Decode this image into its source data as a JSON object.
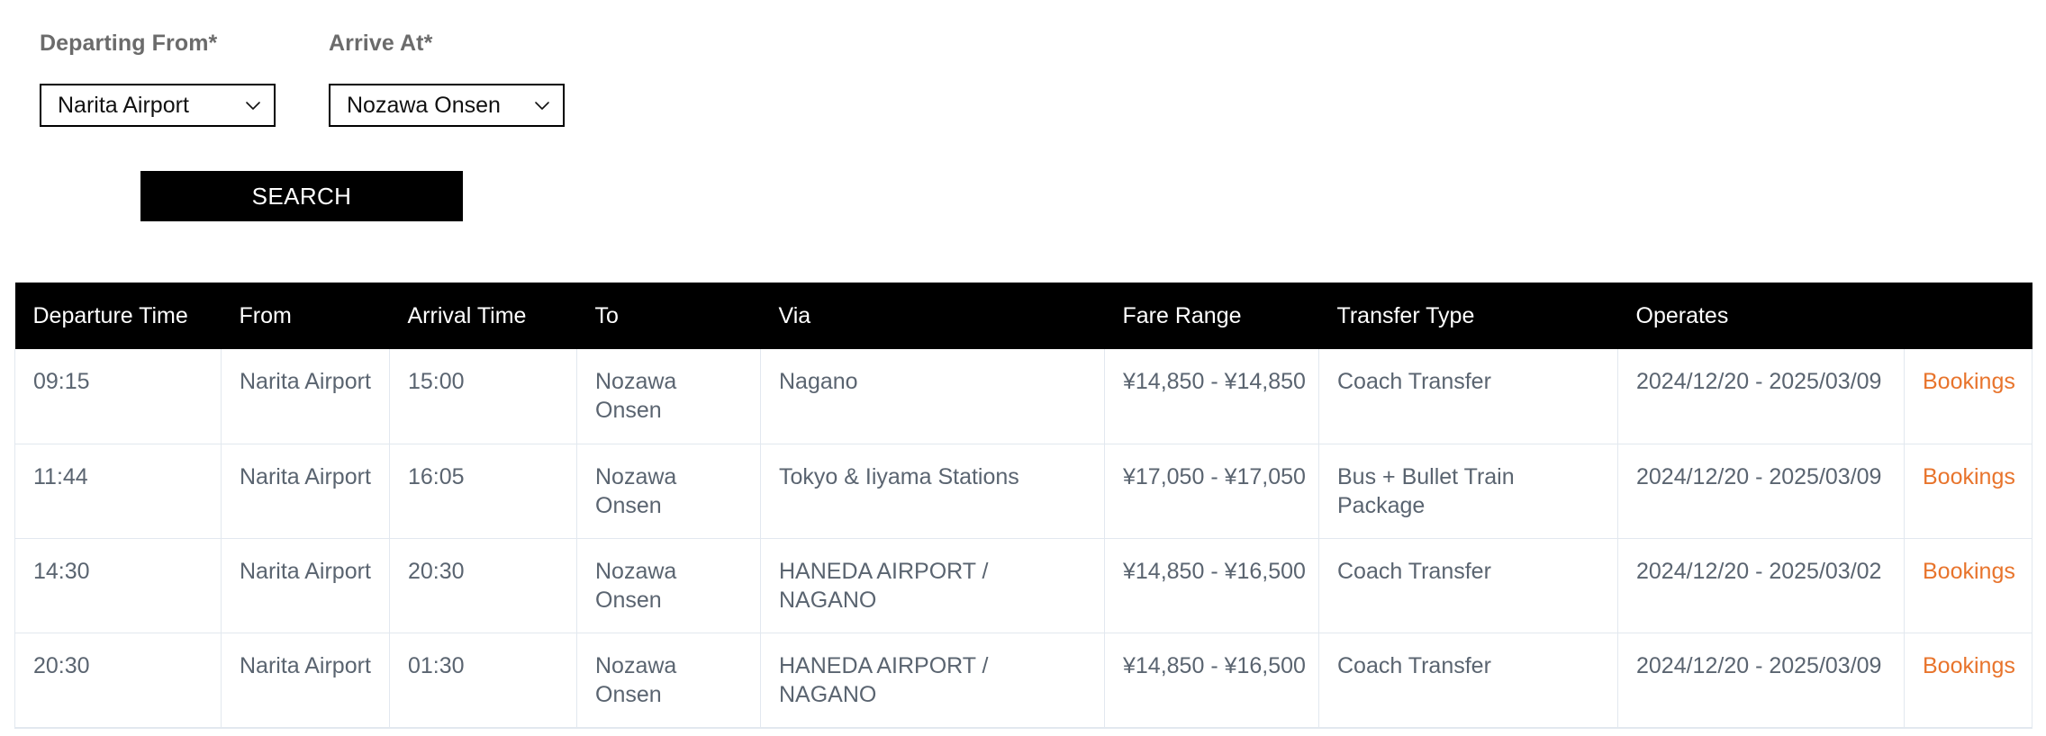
{
  "form": {
    "departing_label": "Departing From",
    "departing_required_mark": "*",
    "arrive_label": "Arrive At",
    "arrive_required_mark": "*",
    "departing_value": "Narita Airport",
    "arrive_value": "Nozawa Onsen",
    "search_button": "SEARCH"
  },
  "table": {
    "headers": [
      "Departure Time",
      "From",
      "Arrival Time",
      "To",
      "Via",
      "Fare Range",
      "Transfer Type",
      "Operates",
      ""
    ],
    "rows": [
      {
        "departure_time": "09:15",
        "from": "Narita Airport",
        "arrival_time": "15:00",
        "to": "Nozawa Onsen",
        "via": "Nagano",
        "fare_range": "¥14,850 - ¥14,850",
        "transfer_type": "Coach Transfer",
        "operates": "2024/12/20 - 2025/03/09",
        "bookings_label": "Bookings"
      },
      {
        "departure_time": "11:44",
        "from": "Narita Airport",
        "arrival_time": "16:05",
        "to": "Nozawa Onsen",
        "via": "Tokyo & Iiyama Stations",
        "fare_range": "¥17,050 - ¥17,050",
        "transfer_type": "Bus + Bullet Train Package",
        "operates": "2024/12/20 - 2025/03/09",
        "bookings_label": "Bookings"
      },
      {
        "departure_time": "14:30",
        "from": "Narita Airport",
        "arrival_time": "20:30",
        "to": "Nozawa Onsen",
        "via": "HANEDA AIRPORT / NAGANO",
        "fare_range": "¥14,850 - ¥16,500",
        "transfer_type": "Coach Transfer",
        "operates": "2024/12/20 - 2025/03/02",
        "bookings_label": "Bookings"
      },
      {
        "departure_time": "20:30",
        "from": "Narita Airport",
        "arrival_time": "01:30",
        "to": "Nozawa Onsen",
        "via": "HANEDA AIRPORT / NAGANO",
        "fare_range": "¥14,850 - ¥16,500",
        "transfer_type": "Coach Transfer",
        "operates": "2024/12/20 - 2025/03/09",
        "bookings_label": "Bookings"
      }
    ]
  },
  "colors": {
    "header_bg": "#000000",
    "link_orange": "#e8742c",
    "body_text": "#5a6470",
    "label_text": "#6b6b6b",
    "border": "#e2e8ef"
  }
}
